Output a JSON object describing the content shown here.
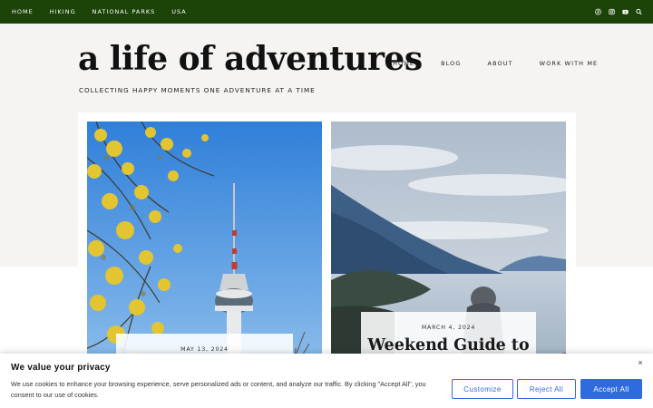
{
  "topbar": {
    "nav": [
      "HOME",
      "HIKING",
      "NATIONAL PARKS",
      "USA"
    ],
    "icons": [
      "pinterest-icon",
      "instagram-icon",
      "youtube-icon",
      "search-icon"
    ],
    "bg_color": "#1c4408"
  },
  "header": {
    "site_title": "a life of adventures",
    "tagline": "COLLECTING HAPPY MOMENTS ONE ADVENTURE AT A TIME",
    "nav": [
      "HOME",
      "BLOG",
      "ABOUT",
      "WORK WITH ME"
    ]
  },
  "posts": [
    {
      "date": "MAY 13, 2024",
      "title": ""
    },
    {
      "date": "MARCH 4, 2024",
      "title": "Weekend Guide to"
    }
  ],
  "cookie": {
    "title": "We value your privacy",
    "text": "We use cookies to enhance your browsing experience, serve personalized ads or content, and analyze our traffic. By clicking \"Accept All\", you consent to our use of cookies.",
    "customize_label": "Customize",
    "reject_label": "Reject All",
    "accept_label": "Accept All",
    "close_symbol": "×",
    "accent_color": "#2f6bdc"
  }
}
